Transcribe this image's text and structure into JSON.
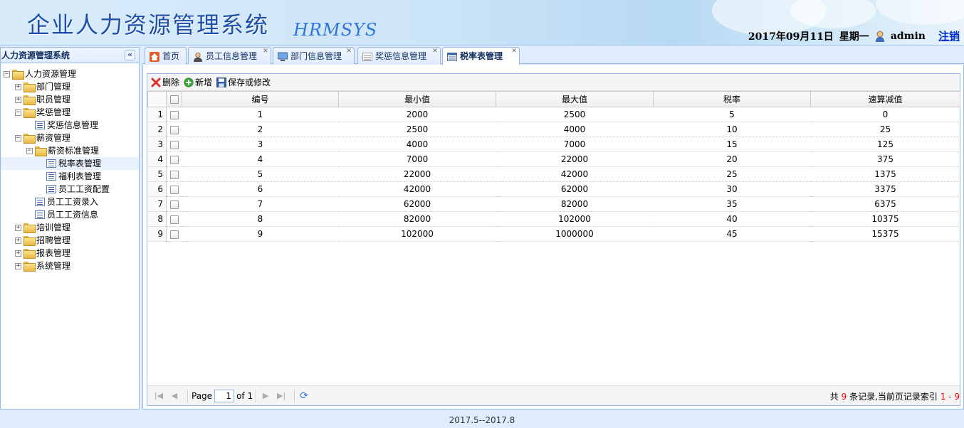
{
  "header": {
    "title": "企业人力资源管理系统",
    "subtitle": "HRMSYS",
    "date": "2017年09月11日",
    "weekday": "星期一",
    "user": "admin",
    "logout": "注销"
  },
  "sidebar": {
    "title": "人力资源管理系统",
    "tree": {
      "root": "人力资源管理",
      "n_dept": "部门管理",
      "n_staff": "职员管理",
      "n_reward": "奖惩管理",
      "n_reward_info": "奖惩信息管理",
      "n_salary": "薪资管理",
      "n_salary_std": "薪资标准管理",
      "n_tax": "税率表管理",
      "n_welfare": "福利表管理",
      "n_wage_cfg": "员工工资配置",
      "n_wage_input": "员工工资录入",
      "n_wage_info": "员工工资信息",
      "n_train": "培训管理",
      "n_recruit": "招聘管理",
      "n_report": "报表管理",
      "n_system": "系统管理"
    }
  },
  "tabs": [
    {
      "label": "首页"
    },
    {
      "label": "员工信息管理"
    },
    {
      "label": "部门信息管理"
    },
    {
      "label": "奖惩信息管理"
    },
    {
      "label": "税率表管理"
    }
  ],
  "toolbar": {
    "delete": "删除",
    "add": "新增",
    "save": "保存或修改"
  },
  "table": {
    "columns": [
      "编号",
      "最小值",
      "最大值",
      "税率",
      "速算减值"
    ],
    "rows": [
      [
        "1",
        "1",
        "2000",
        "2500",
        "5",
        "0"
      ],
      [
        "2",
        "2",
        "2500",
        "4000",
        "10",
        "25"
      ],
      [
        "3",
        "3",
        "4000",
        "7000",
        "15",
        "125"
      ],
      [
        "4",
        "4",
        "7000",
        "22000",
        "20",
        "375"
      ],
      [
        "5",
        "5",
        "22000",
        "42000",
        "25",
        "1375"
      ],
      [
        "6",
        "6",
        "42000",
        "62000",
        "30",
        "3375"
      ],
      [
        "7",
        "7",
        "62000",
        "82000",
        "35",
        "6375"
      ],
      [
        "8",
        "8",
        "82000",
        "102000",
        "40",
        "10375"
      ],
      [
        "9",
        "9",
        "102000",
        "1000000",
        "45",
        "15375"
      ]
    ]
  },
  "pager": {
    "page_label": "Page",
    "page_value": "1",
    "of_label": "of 1",
    "info_prefix": "共",
    "info_count": "9",
    "info_mid": "条记录,当前页记录索引",
    "info_range": "1 - 9"
  },
  "footer": {
    "text": "2017.5--2017.8"
  }
}
